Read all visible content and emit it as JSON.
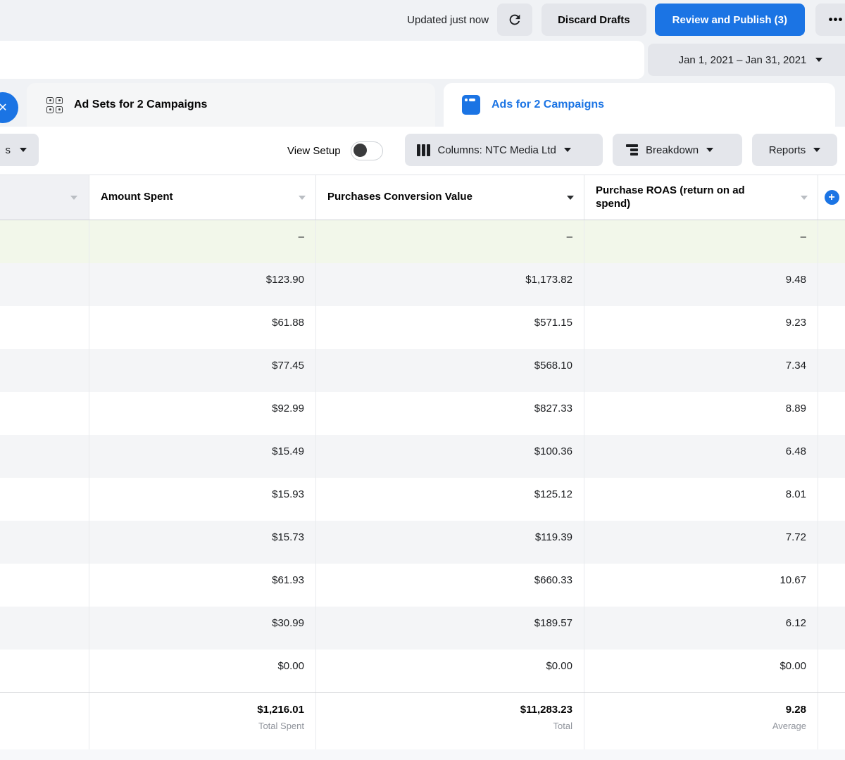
{
  "topbar": {
    "updated_text": "Updated just now",
    "discard_label": "Discard Drafts",
    "publish_label": "Review and Publish (3)",
    "more_label": "•••"
  },
  "date_filter": {
    "range": "Jan 1, 2021 – Jan 31, 2021"
  },
  "tabs": {
    "close_badge": "✕",
    "adsets_label": "Ad Sets for 2 Campaigns",
    "ads_label": "Ads for 2 Campaigns"
  },
  "toolbar": {
    "partial_label": "s",
    "view_setup_label": "View Setup",
    "columns_label": "Columns: NTC Media Ltd",
    "breakdown_label": "Breakdown",
    "reports_label": "Reports"
  },
  "table": {
    "headers": [
      "Amount Spent",
      "Purchases Conversion Value",
      "Purchase ROAS (return on ad spend)"
    ],
    "add_column_glyph": "+",
    "rows": [
      [
        "–",
        "–",
        "–"
      ],
      [
        "$123.90",
        "$1,173.82",
        "9.48"
      ],
      [
        "$61.88",
        "$571.15",
        "9.23"
      ],
      [
        "$77.45",
        "$568.10",
        "7.34"
      ],
      [
        "$92.99",
        "$827.33",
        "8.89"
      ],
      [
        "$15.49",
        "$100.36",
        "6.48"
      ],
      [
        "$15.93",
        "$125.12",
        "8.01"
      ],
      [
        "$15.73",
        "$119.39",
        "7.72"
      ],
      [
        "$61.93",
        "$660.33",
        "10.67"
      ],
      [
        "$30.99",
        "$189.57",
        "6.12"
      ],
      [
        "$0.00",
        "$0.00",
        "$0.00"
      ]
    ],
    "totals": {
      "amount_spent": {
        "value": "$1,216.01",
        "caption": "Total Spent"
      },
      "conversion_value": {
        "value": "$11,283.23",
        "caption": "Total"
      },
      "roas": {
        "value": "9.28",
        "caption": "Average"
      }
    }
  },
  "colors": {
    "accent_blue": "#1b74e4",
    "draft_row_green": "#f2f7ea",
    "alt_row_gray": "#f4f5f7",
    "button_gray": "#e4e6eb"
  }
}
